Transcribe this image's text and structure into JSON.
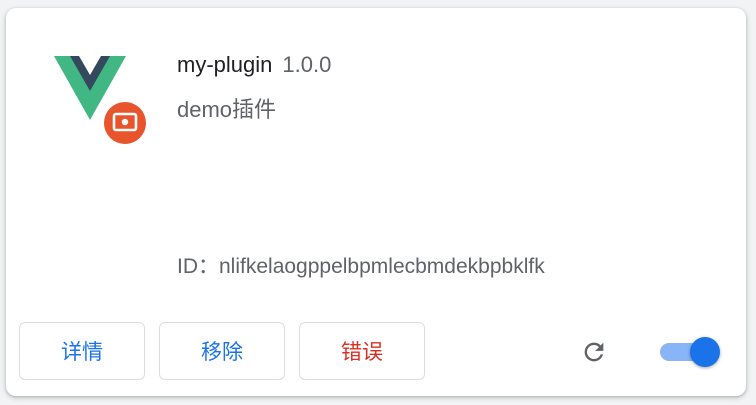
{
  "extension": {
    "name": "my-plugin",
    "version": "1.0.0",
    "description": "demo插件",
    "id_label": "ID：",
    "id": "nlifkelaogppelbpmlecbmdekbpbklfk",
    "id_text": "ID：nlifkelaogppelbpmlecbmdekbpbklfk",
    "enabled": true
  },
  "buttons": {
    "details": "详情",
    "remove": "移除",
    "errors": "错误"
  },
  "icons": {
    "logo": "vue-logo-icon",
    "badge": "inspect-view-badge-icon",
    "reload": "reload-icon"
  },
  "colors": {
    "vue_green": "#41b883",
    "vue_dark": "#35495e",
    "badge": "#e8542c",
    "accent": "#1a73e8",
    "error": "#d93025"
  }
}
